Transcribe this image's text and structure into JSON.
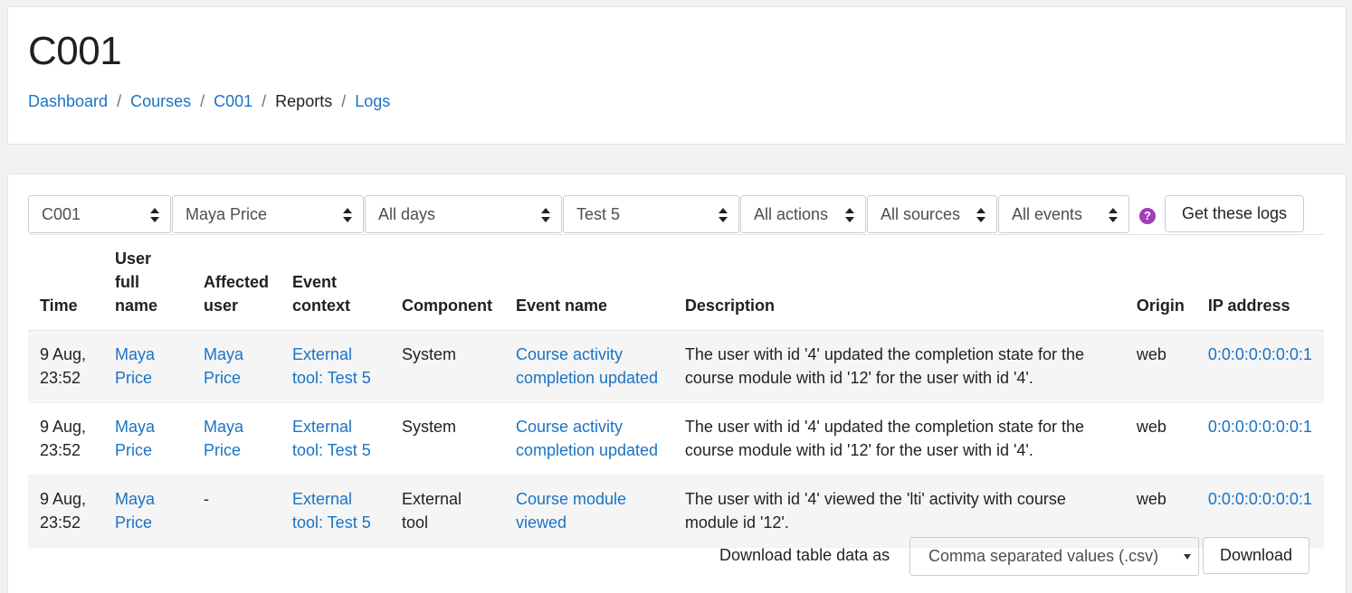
{
  "header": {
    "title": "C001",
    "breadcrumb": [
      {
        "label": "Dashboard"
      },
      {
        "label": "Courses"
      },
      {
        "label": "C001"
      },
      {
        "label": "Reports"
      },
      {
        "label": "Logs"
      }
    ]
  },
  "filters": {
    "course": "C001",
    "user": "Maya Price",
    "days": "All days",
    "activity": "Test 5",
    "actions": "All actions",
    "sources": "All sources",
    "events": "All events",
    "help_icon": "?",
    "submit_label": "Get these logs"
  },
  "table": {
    "headers": {
      "time": "Time",
      "user_full_name": "User full name",
      "affected_user": "Affected user",
      "event_context": "Event context",
      "component": "Component",
      "event_name": "Event name",
      "description": "Description",
      "origin": "Origin",
      "ip_address": "IP address"
    },
    "rows": [
      {
        "time": "9 Aug, 23:52",
        "user_full_name": "Maya Price",
        "affected_user": "Maya Price",
        "event_context": "External tool: Test 5",
        "component": "System",
        "event_name": "Course activity completion updated",
        "description": "The user with id '4' updated the completion state for the course module with id '12' for the user with id '4'.",
        "origin": "web",
        "ip_address": "0:0:0:0:0:0:0:1"
      },
      {
        "time": "9 Aug, 23:52",
        "user_full_name": "Maya Price",
        "affected_user": "Maya Price",
        "event_context": "External tool: Test 5",
        "component": "System",
        "event_name": "Course activity completion updated",
        "description": "The user with id '4' updated the completion state for the course module with id '12' for the user with id '4'.",
        "origin": "web",
        "ip_address": "0:0:0:0:0:0:0:1"
      },
      {
        "time": "9 Aug, 23:52",
        "user_full_name": "Maya Price",
        "affected_user": "-",
        "event_context": "External tool: Test 5",
        "component": "External tool",
        "event_name": "Course module viewed",
        "description": "The user with id '4' viewed the 'lti' activity with course module id '12'.",
        "origin": "web",
        "ip_address": "0:0:0:0:0:0:0:1"
      }
    ]
  },
  "download": {
    "label": "Download table data as",
    "format": "Comma separated values (.csv)",
    "button_label": "Download"
  }
}
